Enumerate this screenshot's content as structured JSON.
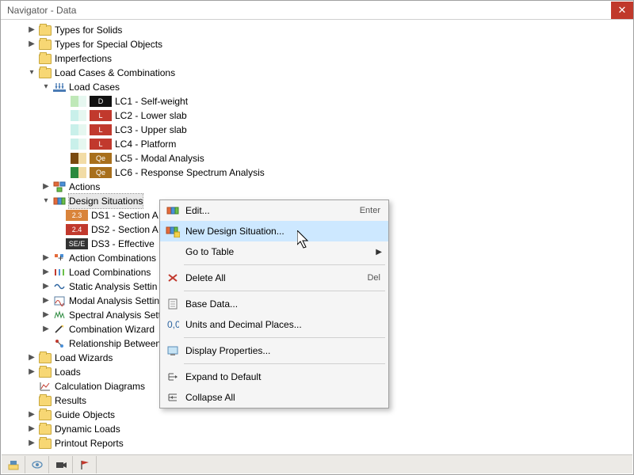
{
  "window": {
    "title": "Navigator - Data"
  },
  "tree": {
    "types_solids": "Types for Solids",
    "types_special": "Types for Special Objects",
    "imperfections": "Imperfections",
    "lcc": "Load Cases & Combinations",
    "load_cases": "Load Cases",
    "lc1": "LC1 - Self-weight",
    "lc2": "LC2 - Lower slab",
    "lc3": "LC3 - Upper slab",
    "lc4": "LC4 - Platform",
    "lc5": "LC5 - Modal Analysis",
    "lc6": "LC6 - Response Spectrum Analysis",
    "actions": "Actions",
    "design_situations": "Design Situations",
    "ds1": "DS1 - Section A",
    "ds2": "DS2 - Section A",
    "ds3": "DS3 - Effective",
    "action_combinations": "Action Combinations",
    "load_combinations": "Load Combinations",
    "static_analysis": "Static Analysis Settin",
    "modal_analysis": "Modal Analysis Settin",
    "spectral_analysis": "Spectral Analysis Sett",
    "combination_wizard": "Combination Wizard",
    "relationship": "Relationship Between",
    "load_wizards": "Load Wizards",
    "loads": "Loads",
    "calc_diagrams": "Calculation Diagrams",
    "results": "Results",
    "guide_objects": "Guide Objects",
    "dynamic_loads": "Dynamic Loads",
    "printout": "Printout Reports"
  },
  "badges": {
    "d": "D",
    "l": "L",
    "qe": "Qe",
    "b23": "2.3",
    "b24": "2.4",
    "see": "SE/E"
  },
  "colors": {
    "d_bg": "#111111",
    "l_bg": "#c1392d",
    "qe_bg": "#a86f1c",
    "lc1_c": "#bfe8b8",
    "lc2_c": "#9be2da",
    "lc3_c": "#9be2da",
    "lc4_c": "#9be2da",
    "lc5_c": "#7a4a0f",
    "lc5_c2": "#f2dca6",
    "lc6_c": "#2c8a3e",
    "lc6_c2": "#f2dca6",
    "b23_bg": "#d9843b",
    "b24_bg": "#c1392d",
    "see_bg": "#333333"
  },
  "context_menu": {
    "edit": "Edit...",
    "edit_accel": "Enter",
    "new_ds": "New Design Situation...",
    "goto_table": "Go to Table",
    "delete_all": "Delete All",
    "delete_accel": "Del",
    "base_data": "Base Data...",
    "units": "Units and Decimal Places...",
    "display_props": "Display Properties...",
    "expand": "Expand to Default",
    "collapse": "Collapse All"
  }
}
